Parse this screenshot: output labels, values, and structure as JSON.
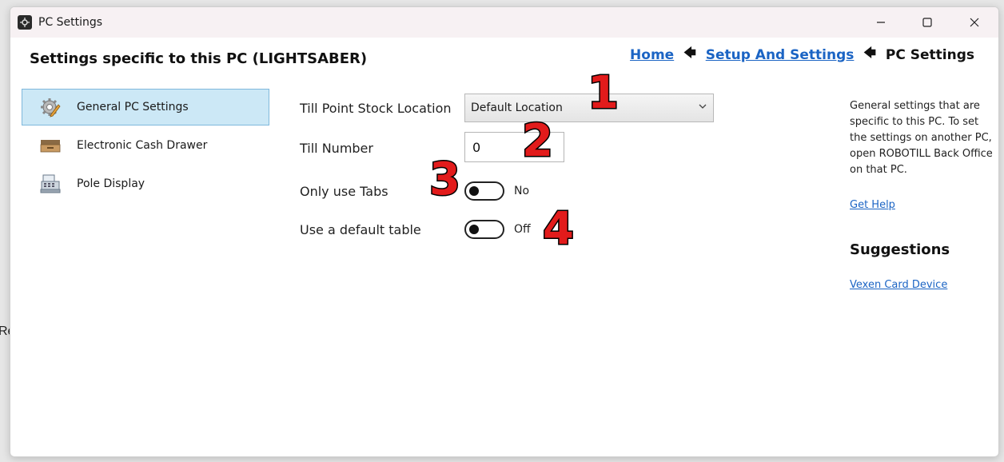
{
  "background": {
    "peek_text": "Re"
  },
  "window": {
    "title": "PC Settings",
    "icon": "robotill-app-icon",
    "controls": {
      "minimize": "minimize-icon",
      "maximize": "maximize-icon",
      "close": "close-icon"
    }
  },
  "header": {
    "title": "Settings specific to this PC (LIGHTSABER)",
    "breadcrumb": {
      "home": "Home",
      "setup": "Setup And Settings",
      "current": "PC Settings",
      "separator": "🡄"
    }
  },
  "sidebar": {
    "items": [
      {
        "label": "General PC Settings",
        "icon": "gear-pencil-icon",
        "active": true
      },
      {
        "label": "Electronic Cash Drawer",
        "icon": "cash-drawer-icon",
        "active": false
      },
      {
        "label": "Pole Display",
        "icon": "cash-register-icon",
        "active": false
      }
    ]
  },
  "form": {
    "stock_location": {
      "label": "Till Point Stock Location",
      "value": "Default Location"
    },
    "till_number": {
      "label": "Till Number",
      "value": "0"
    },
    "only_tabs": {
      "label": "Only use Tabs",
      "state": "No",
      "on": false
    },
    "default_table": {
      "label": "Use a default table",
      "state": "Off",
      "on": false
    }
  },
  "annotations": {
    "m1": "1",
    "m2": "2",
    "m3": "3",
    "m4": "4",
    "color": "#e21b1b"
  },
  "help": {
    "text": "General settings that are specific to this PC. To set the settings on another PC, open ROBOTILL Back Office on that PC.",
    "link": "Get Help",
    "suggestions_title": "Suggestions",
    "suggestion_link": "Vexen Card Device"
  },
  "colors": {
    "accent": "#1b64c4",
    "selected_bg": "#cce8f6",
    "selected_border": "#7fb8dc"
  }
}
